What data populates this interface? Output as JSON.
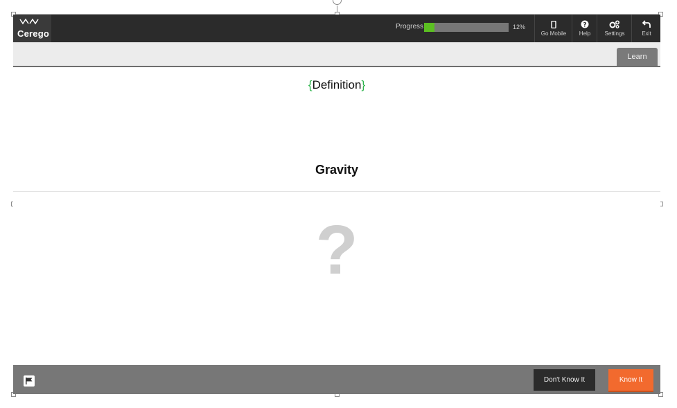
{
  "app": {
    "logo_text": "Cerego"
  },
  "progress": {
    "label": "Progress",
    "value_pct": 12,
    "text": "12%"
  },
  "toolbar": {
    "go_mobile": "Go Mobile",
    "help": "Help",
    "settings": "Settings",
    "exit": "Exit"
  },
  "tabs": {
    "learn": "Learn"
  },
  "card": {
    "definition_label": "Definition",
    "term": "Gravity",
    "answer_placeholder": "?"
  },
  "actions": {
    "dont_know": "Don't Know It",
    "know_it": "Know It"
  },
  "colors": {
    "accent_green": "#5bbf21",
    "brace_green": "#2bb34a",
    "know_it_orange": "#f26a2e",
    "topbar": "#2b2b2b"
  }
}
